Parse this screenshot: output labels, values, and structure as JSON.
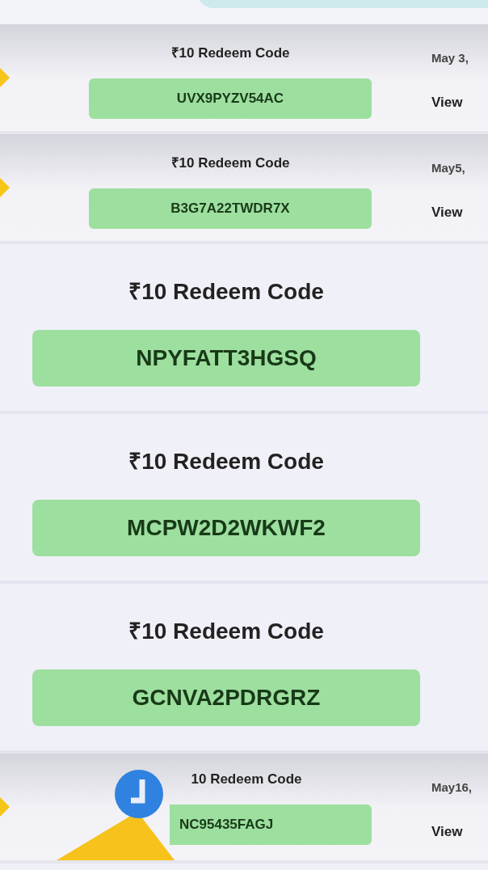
{
  "rows": [
    {
      "kind": "compact",
      "title": "₹10 Redeem Code",
      "code": "UVX9PYZV54AC",
      "date": "May 3,",
      "action": "View"
    },
    {
      "kind": "compact",
      "title": "₹10 Redeem Code",
      "code": "B3G7A22TWDR7X",
      "date": "May5,",
      "action": "View"
    },
    {
      "kind": "expanded",
      "title": "₹10 Redeem Code",
      "code": "NPYFATT3HGSQ"
    },
    {
      "kind": "expanded",
      "title": "₹10 Redeem Code",
      "code": "MCPW2D2WKWF2"
    },
    {
      "kind": "expanded",
      "title": "₹10 Redeem Code",
      "code": "GCNVA2PDRGRZ"
    },
    {
      "kind": "covered",
      "title": "10 Redeem Code",
      "code": "NC95435FAGJ",
      "date": "May16,",
      "action": "View"
    }
  ]
}
